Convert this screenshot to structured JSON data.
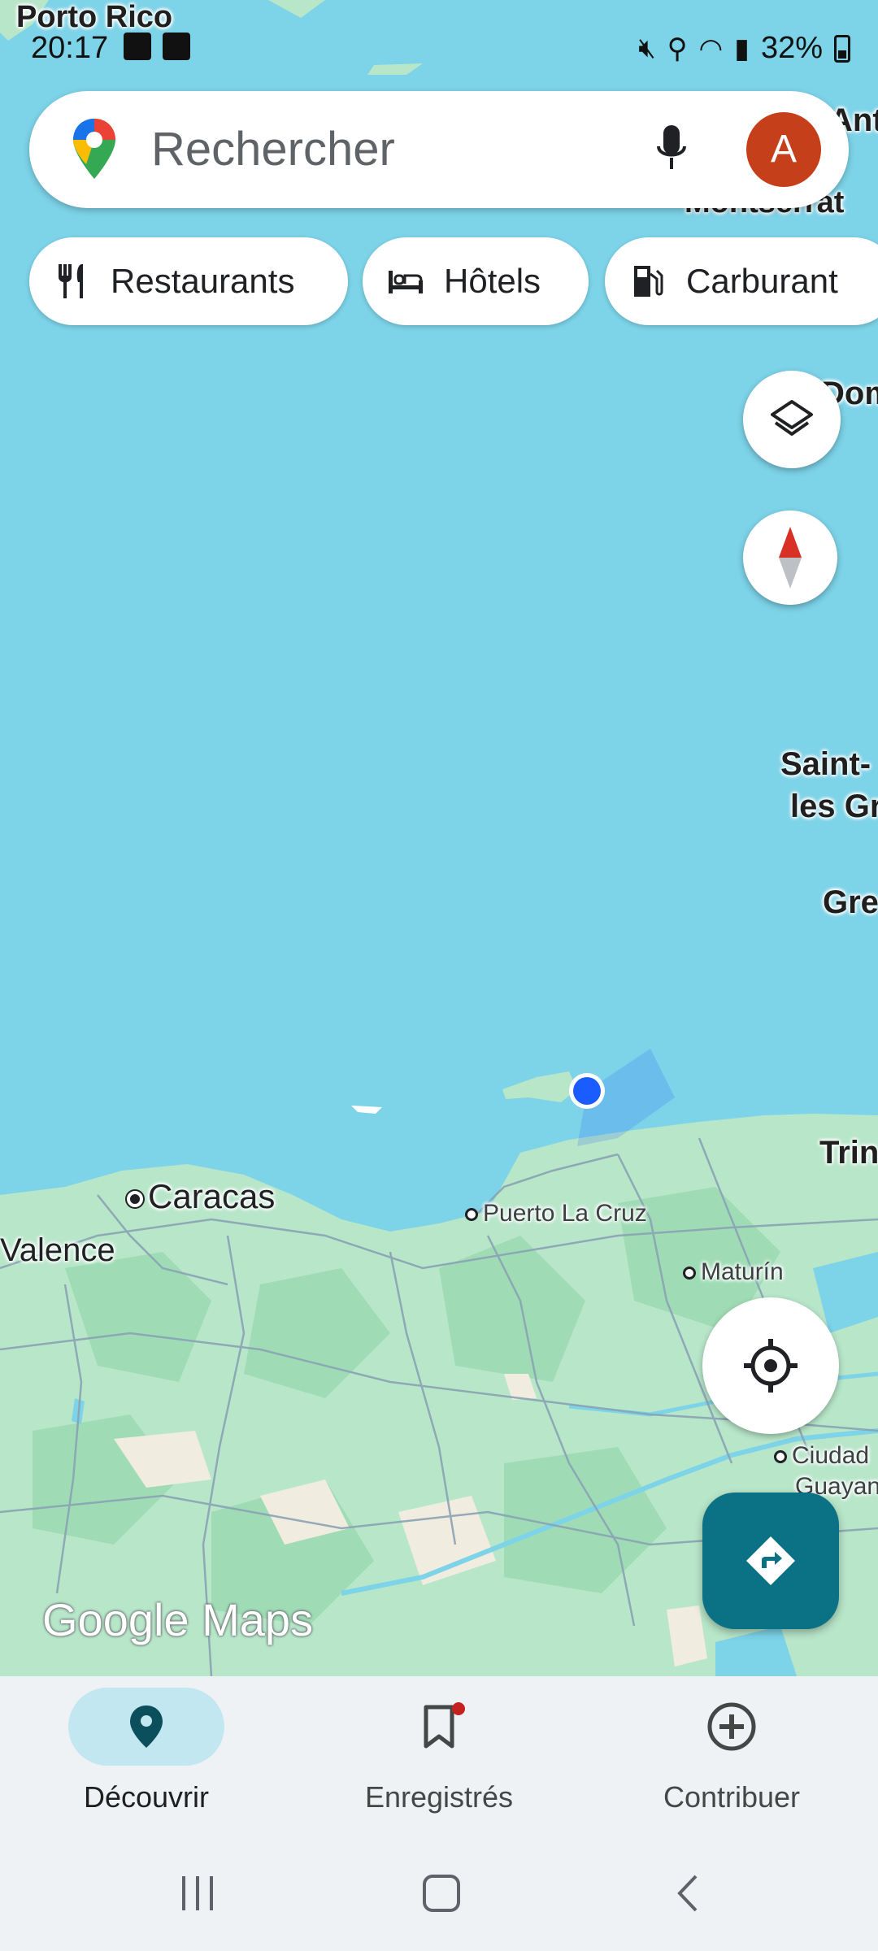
{
  "status_bar": {
    "time": "20:17",
    "battery": "32%",
    "icons": [
      "gallery-icon",
      "checkbox-icon",
      "mute-icon",
      "location-icon",
      "wifi-icon",
      "signal-icon",
      "battery-icon"
    ]
  },
  "search": {
    "placeholder": "Rechercher",
    "avatar_letter": "A",
    "colors": {
      "avatar": "#c5401a"
    }
  },
  "chips": [
    {
      "label": "Restaurants",
      "icon": "fork-knife-icon"
    },
    {
      "label": "Hôtels",
      "icon": "bed-icon"
    },
    {
      "label": "Carburant",
      "icon": "fuel-icon"
    }
  ],
  "map_labels": {
    "porto_rico": "Porto Rico",
    "ant": "Ant",
    "montserrat": "Montserrat",
    "dom": "Dom",
    "saint_1": "Saint-",
    "saint_2": "les Gr",
    "gre": "Gre",
    "trin": "Trin",
    "caracas": "Caracas",
    "valence": "Valence",
    "puerto_la_cruz": "Puerto La Cruz",
    "maturin": "Maturín",
    "ciudad_1": "Ciudad",
    "ciudad_2": "Guayan"
  },
  "branding": {
    "logo": "Google Maps"
  },
  "bottom_nav": [
    {
      "label": "Découvrir",
      "icon": "explore-pin-icon",
      "active": true
    },
    {
      "label": "Enregistrés",
      "icon": "bookmark-icon",
      "active": false
    },
    {
      "label": "Contribuer",
      "icon": "add-circle-icon",
      "active": false
    }
  ],
  "colors": {
    "sea": "#7dd3e8",
    "land": "#b8e6c9",
    "accent": "#0b7285",
    "location_dot": "#1a5cff"
  }
}
